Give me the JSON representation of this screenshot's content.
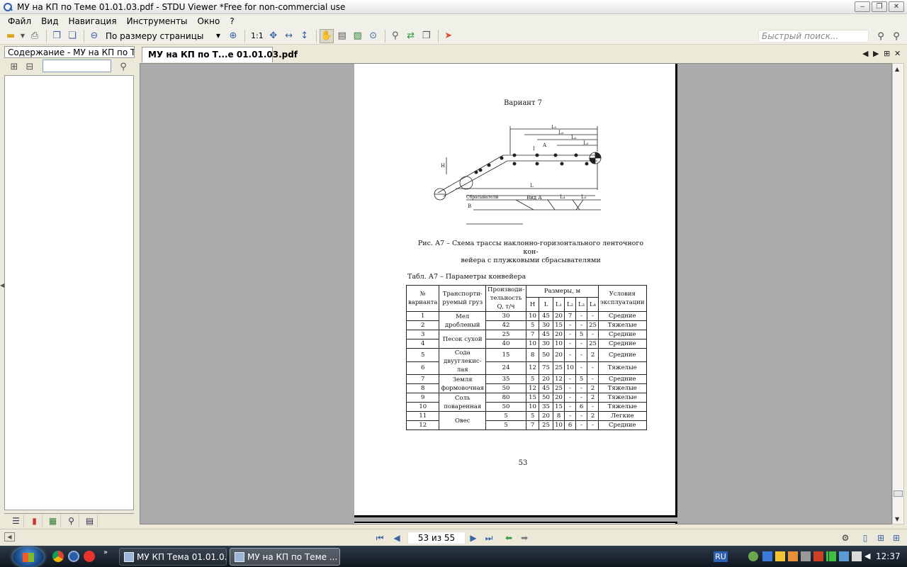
{
  "window": {
    "title": "МУ на КП по Теме 01.01.03.pdf - STDU Viewer *Free for non-commercial use",
    "minimize": "‒",
    "restore": "❐",
    "close": "✕"
  },
  "menu": [
    "Файл",
    "Вид",
    "Навигация",
    "Инструменты",
    "Окно",
    "?"
  ],
  "toolbar": {
    "zoom_mode": "По размеру страницы",
    "actual_size": "1:1",
    "quick_search_placeholder": "Быстрый поиск..."
  },
  "left_panel": {
    "tab_title": "Содержание - МУ на КП по Теме 01.01.03.pdf"
  },
  "document": {
    "tab_label": "МУ на КП по Т...е 01.01.03.pdf"
  },
  "page": {
    "variant": "Вариант 7",
    "figure_caption": "Рис. А7 – Схема трассы наклонно-горизонтального ленточного кон-\nвейера с плужковыми сбрасывателями",
    "diagram_labels": {
      "L1": "L₁",
      "L0": "L₀",
      "L2": "L₂",
      "L3": "L₃",
      "H": "H",
      "A": "A",
      "I": "I",
      "L": "L",
      "view": "Вид А",
      "L4": "L₄",
      "Lv": "L₃",
      "B": "B",
      "note": "Сбрасыватели"
    },
    "table_title": "Табл. А7 – Параметры конвейера",
    "table": {
      "h_variant": "№\nварианта",
      "h_cargo": "Транспорти-\nруемый груз",
      "h_productivity": "Производи-\nтельность\nQ, т/ч",
      "h_sizes": "Размеры, м",
      "h_conditions": "Условия\nэксплуатации",
      "h_H": "H",
      "h_L": "L",
      "h_L1": "L₁",
      "h_L2": "L₂",
      "h_L3": "L₃",
      "h_L4": "L₄",
      "cargo": [
        {
          "name": "Мел\nдробленый",
          "rows": 2
        },
        {
          "name": "Песок сухой",
          "rows": 2
        },
        {
          "name": "Сода\nдвууглекис-\nлая",
          "rows": 2
        },
        {
          "name": "Земля\nформовочная",
          "rows": 2
        },
        {
          "name": "Соль\nповаренная",
          "rows": 2
        },
        {
          "name": "Овес",
          "rows": 2
        }
      ],
      "rows": [
        [
          "1",
          "30",
          "10",
          "45",
          "20",
          "7",
          "-",
          "-",
          "Средние"
        ],
        [
          "2",
          "42",
          "5",
          "30",
          "15",
          "-",
          "-",
          "25",
          "Тяжелые"
        ],
        [
          "3",
          "25",
          "7",
          "45",
          "20",
          "-",
          "5",
          "-",
          "Средние"
        ],
        [
          "4",
          "40",
          "10",
          "30",
          "10",
          "-",
          "-",
          "25",
          "Средние"
        ],
        [
          "5",
          "15",
          "8",
          "50",
          "20",
          "-",
          "-",
          "2",
          "Средние"
        ],
        [
          "6",
          "24",
          "12",
          "75",
          "25",
          "10",
          "-",
          "-",
          "Тяжелые"
        ],
        [
          "7",
          "35",
          "5",
          "20",
          "12",
          "-",
          "5",
          "-",
          "Средние"
        ],
        [
          "8",
          "50",
          "12",
          "45",
          "25",
          "-",
          "-",
          "2",
          "Тяжелые"
        ],
        [
          "9",
          "80",
          "15",
          "50",
          "20",
          "-",
          "-",
          "2",
          "Тяжелые"
        ],
        [
          "10",
          "50",
          "10",
          "35",
          "15",
          "-",
          "6",
          "-",
          "Тяжелые"
        ],
        [
          "11",
          "5",
          "5",
          "20",
          "8",
          "-",
          "-",
          "2",
          "Легкие"
        ],
        [
          "12",
          "5",
          "7",
          "25",
          "10",
          "6",
          "-",
          "-",
          "Средние"
        ]
      ]
    },
    "page_number": "53"
  },
  "navigation": {
    "page_indicator": "53 из 55"
  },
  "taskbar": {
    "task1": "МУ КП Тема 01.01.0...",
    "task2": "МУ на КП по Теме ...",
    "lang": "RU",
    "time": "12:37"
  }
}
